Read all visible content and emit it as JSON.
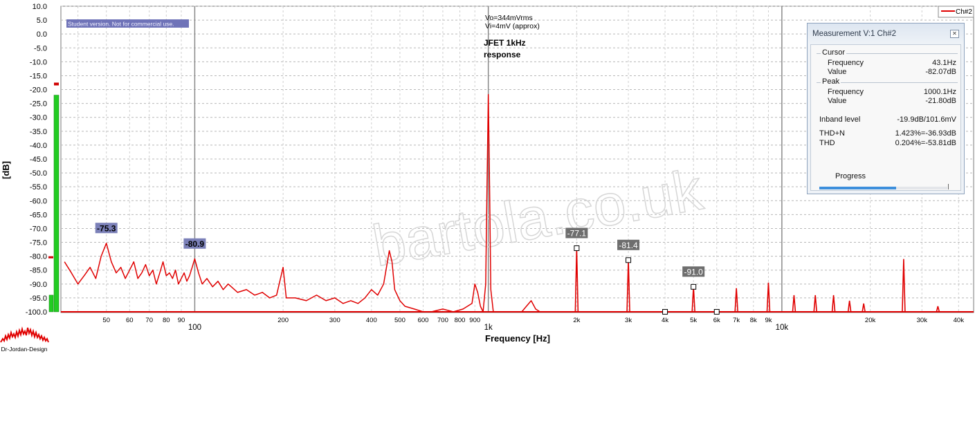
{
  "chart_data": {
    "type": "line",
    "xlabel": "Frequency [Hz]",
    "ylabel": "[dB]",
    "x_scale": "log",
    "xlim": [
      35,
      45000
    ],
    "ylim": [
      -100,
      10
    ],
    "y_ticks": [
      "10.0",
      "5.0",
      "0.0",
      "-5.0",
      "-10.0",
      "-15.0",
      "-20.0",
      "-25.0",
      "-30.0",
      "-35.0",
      "-40.0",
      "-45.0",
      "-50.0",
      "-55.0",
      "-60.0",
      "-65.0",
      "-70.0",
      "-75.0",
      "-80.0",
      "-85.0",
      "-90.0",
      "-95.0",
      "-100.0"
    ],
    "x_ticks": [
      {
        "f": 50,
        "label": "50"
      },
      {
        "f": 60,
        "label": "60"
      },
      {
        "f": 70,
        "label": "70"
      },
      {
        "f": 80,
        "label": "80"
      },
      {
        "f": 90,
        "label": "90"
      },
      {
        "f": 100,
        "label": "100",
        "major": true
      },
      {
        "f": 200,
        "label": "200"
      },
      {
        "f": 300,
        "label": "300"
      },
      {
        "f": 400,
        "label": "400"
      },
      {
        "f": 500,
        "label": "500"
      },
      {
        "f": 600,
        "label": "600"
      },
      {
        "f": 700,
        "label": "700"
      },
      {
        "f": 800,
        "label": "800"
      },
      {
        "f": 900,
        "label": "900"
      },
      {
        "f": 1000,
        "label": "1k",
        "major": true
      },
      {
        "f": 2000,
        "label": "2k"
      },
      {
        "f": 3000,
        "label": "3k"
      },
      {
        "f": 4000,
        "label": "4k"
      },
      {
        "f": 5000,
        "label": "5k"
      },
      {
        "f": 6000,
        "label": "6k"
      },
      {
        "f": 7000,
        "label": "7k"
      },
      {
        "f": 8000,
        "label": "8k"
      },
      {
        "f": 9000,
        "label": "9k"
      },
      {
        "f": 10000,
        "label": "10k",
        "major": true
      },
      {
        "f": 20000,
        "label": "20k"
      },
      {
        "f": 30000,
        "label": "30k"
      },
      {
        "f": 40000,
        "label": "40k"
      }
    ],
    "grid": true,
    "legend": "top-right",
    "series": [
      {
        "name": "Ch#2",
        "color": "#e00000",
        "noise_floor": [
          [
            36,
            -82
          ],
          [
            38,
            -86
          ],
          [
            40,
            -90
          ],
          [
            42,
            -87
          ],
          [
            44,
            -84
          ],
          [
            46,
            -88
          ],
          [
            48,
            -80
          ],
          [
            50,
            -75.3
          ],
          [
            52,
            -82
          ],
          [
            54,
            -86
          ],
          [
            56,
            -84
          ],
          [
            58,
            -88
          ],
          [
            60,
            -85
          ],
          [
            62,
            -82
          ],
          [
            64,
            -88
          ],
          [
            66,
            -86
          ],
          [
            68,
            -83
          ],
          [
            70,
            -87
          ],
          [
            72,
            -85
          ],
          [
            74,
            -90
          ],
          [
            76,
            -86
          ],
          [
            78,
            -82
          ],
          [
            80,
            -87
          ],
          [
            82,
            -86
          ],
          [
            84,
            -88
          ],
          [
            86,
            -85
          ],
          [
            88,
            -90
          ],
          [
            90,
            -88
          ],
          [
            92,
            -86
          ],
          [
            94,
            -89
          ],
          [
            96,
            -87
          ],
          [
            98,
            -84
          ],
          [
            100,
            -80.9
          ],
          [
            103,
            -86
          ],
          [
            106,
            -90
          ],
          [
            110,
            -88
          ],
          [
            115,
            -91
          ],
          [
            120,
            -89
          ],
          [
            125,
            -92
          ],
          [
            130,
            -90
          ],
          [
            140,
            -93
          ],
          [
            150,
            -92
          ],
          [
            160,
            -94
          ],
          [
            170,
            -93
          ],
          [
            180,
            -95
          ],
          [
            190,
            -94
          ],
          [
            200,
            -84
          ],
          [
            205,
            -95
          ],
          [
            220,
            -95
          ],
          [
            240,
            -96
          ],
          [
            260,
            -94
          ],
          [
            280,
            -96
          ],
          [
            300,
            -95
          ],
          [
            320,
            -97
          ],
          [
            340,
            -96
          ],
          [
            360,
            -97
          ],
          [
            380,
            -95
          ],
          [
            400,
            -92
          ],
          [
            420,
            -94
          ],
          [
            440,
            -90
          ],
          [
            460,
            -78
          ],
          [
            470,
            -82
          ],
          [
            480,
            -92
          ],
          [
            500,
            -96
          ],
          [
            520,
            -98
          ],
          [
            560,
            -99
          ],
          [
            600,
            -100
          ],
          [
            640,
            -100
          ],
          [
            700,
            -99
          ],
          [
            760,
            -100
          ],
          [
            820,
            -99
          ],
          [
            880,
            -97
          ],
          [
            900,
            -90
          ],
          [
            920,
            -93
          ],
          [
            940,
            -98
          ],
          [
            960,
            -100
          ],
          [
            980,
            -90
          ],
          [
            990,
            -55
          ],
          [
            1000,
            -21.8
          ],
          [
            1010,
            -55
          ],
          [
            1020,
            -92
          ],
          [
            1040,
            -100
          ],
          [
            1300,
            -100
          ],
          [
            1400,
            -96
          ],
          [
            1450,
            -99
          ],
          [
            1500,
            -100
          ],
          [
            45000,
            -100
          ]
        ],
        "harmonics": [
          {
            "f": 2000,
            "db": -77.1
          },
          {
            "f": 3000,
            "db": -81.4
          },
          {
            "f": 5000,
            "db": -91.0
          },
          {
            "f": 7000,
            "db": -91.5
          },
          {
            "f": 9000,
            "db": -89.5
          },
          {
            "f": 11000,
            "db": -94
          },
          {
            "f": 13000,
            "db": -94
          },
          {
            "f": 15000,
            "db": -94
          },
          {
            "f": 17000,
            "db": -96
          },
          {
            "f": 19000,
            "db": -97
          },
          {
            "f": 26000,
            "db": -81
          },
          {
            "f": 34000,
            "db": -98
          }
        ]
      }
    ],
    "markers": [
      {
        "f": 50,
        "db": -75.3,
        "label": "-75.3",
        "style": "blue"
      },
      {
        "f": 100,
        "db": -80.9,
        "label": "-80.9",
        "style": "blue"
      },
      {
        "f": 2000,
        "db": -77.1,
        "label": "-77.1",
        "style": "gray"
      },
      {
        "f": 3000,
        "db": -81.4,
        "label": "-81.4",
        "style": "gray"
      },
      {
        "f": 5000,
        "db": -91.0,
        "label": "-91.0",
        "style": "gray"
      }
    ],
    "square_markers": [
      {
        "f": 2000,
        "db": -77.1
      },
      {
        "f": 3000,
        "db": -81.4
      },
      {
        "f": 4000,
        "db": -100
      },
      {
        "f": 5000,
        "db": -91.0
      },
      {
        "f": 6000,
        "db": -100
      }
    ],
    "annotations": {
      "student": "Student version. Not for commercial use.",
      "vo": "Vo=344mVrms",
      "vi": "Vi=4mV (approx)",
      "title_line1": "JFET 1kHz",
      "title_line2": "response",
      "watermark": "bartola.co.uk"
    },
    "level_meter": {
      "value_db": -22,
      "peak_hold_db": -18,
      "second_bar_db": -94
    }
  },
  "logo_text": "Dr-Jordan-Design",
  "measurement": {
    "title": "Measurement V:1 Ch#2",
    "cursor": {
      "group": "Cursor",
      "freq_label": "Frequency",
      "freq": "43.1Hz",
      "value_label": "Value",
      "value": "-82.07dB"
    },
    "peak": {
      "group": "Peak",
      "freq_label": "Frequency",
      "freq": "1000.1Hz",
      "value_label": "Value",
      "value": "-21.80dB"
    },
    "inband": {
      "label": "Inband level",
      "value": "-19.9dB/101.6mV"
    },
    "thdn": {
      "label": "THD+N",
      "value": "1.423%=-36.93dB"
    },
    "thd": {
      "label": "THD",
      "value": "0.204%=-53.81dB"
    },
    "progress_label": "Progress",
    "progress_fraction": 0.6
  }
}
